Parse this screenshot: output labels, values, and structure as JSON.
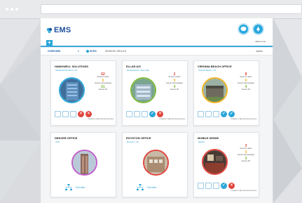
{
  "app": {
    "logo_text": "EMS",
    "add_label": "+",
    "user_name": "admin ems"
  },
  "toolbar": {
    "overview": "OVERVIEW",
    "overview_arrow": "▾",
    "sites": "SITES",
    "sensor_circles": "SENSOR CIRCLES",
    "user": "Admin"
  },
  "stat_labels": {
    "open": "Sensors in alarm",
    "ack": "Sensors acknowledged",
    "ok": "Sensors OK"
  },
  "footnote": "CURRENT STATE ACKNOWLEDGED",
  "subsites_label": "Sub sites",
  "cards": [
    {
      "title": "HAWKWELL SOLUTIONS",
      "location": "Hawkwell Rochford, UK",
      "stats": [
        "62",
        "0",
        "61"
      ],
      "colors": [
        "#e0463d",
        "#f0b323",
        "#7cb83a"
      ],
      "ring": "#2aa6d9"
    },
    {
      "title": "ELLAR A/S",
      "location": "Headquarters, Denmark",
      "stats": [
        "2",
        "0",
        "4"
      ],
      "colors": [
        "#e0463d",
        "#f0b323",
        "#7cb83a"
      ],
      "ring": "#7cb83a"
    },
    {
      "title": "VIRGINIA BEACH OFFICE",
      "location": "Virginia Beach, US",
      "stats": [
        "8",
        "0",
        "4"
      ],
      "colors": [
        "#e0463d",
        "#f0b323",
        "#7cb83a"
      ],
      "ring": "#f0b323"
    },
    {
      "title": "DENVER OFFICE",
      "location": "USA",
      "ring": "#c060c8"
    },
    {
      "title": "ROYSTON OFFICE",
      "location": "Royston, UK",
      "ring": "#e0463d"
    },
    {
      "title": "MOBILE SENSE",
      "location": "Mobile",
      "stats": [
        "3",
        "0",
        "0"
      ],
      "colors": [
        "#e0463d",
        "#f0b323",
        "#7cb83a"
      ],
      "ring": "#e0463d"
    }
  ]
}
